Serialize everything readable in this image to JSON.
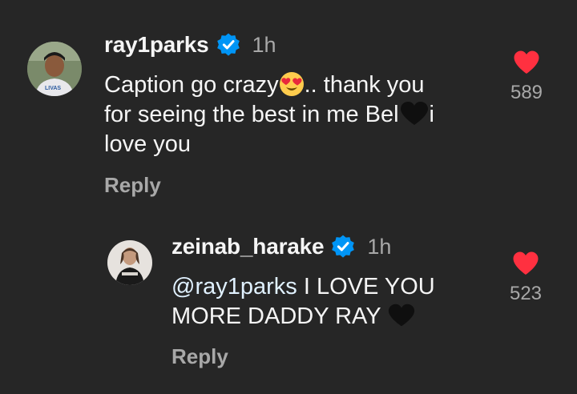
{
  "comments": [
    {
      "username": "ray1parks",
      "time": "1h",
      "text_line1_a": "Caption go crazy",
      "text_line1_b": ".. thank you",
      "text_line2_a": "for seeing the best in me Bel",
      "text_line2_b": "i",
      "text_line3": "love you",
      "reply_label": "Reply",
      "like_count": "589",
      "liked": true
    },
    {
      "username": "zeinab_harake",
      "time": "1h",
      "mention": "@ray1parks",
      "text_line1_b": " I LOVE YOU",
      "text_line2": "MORE DADDY RAY ",
      "reply_label": "Reply",
      "like_count": "523",
      "liked": true
    }
  ],
  "colors": {
    "background": "#262626",
    "text": "#f5f5f5",
    "secondary_text": "#a8a8a8",
    "verified": "#0095f6",
    "heart": "#ff3040",
    "mention": "#e0f1ff"
  },
  "icons": {
    "verified": "verified-badge-icon",
    "heart_eyes": "heart-eyes-emoji-icon",
    "black_heart": "black-heart-emoji-icon",
    "like": "heart-icon"
  }
}
